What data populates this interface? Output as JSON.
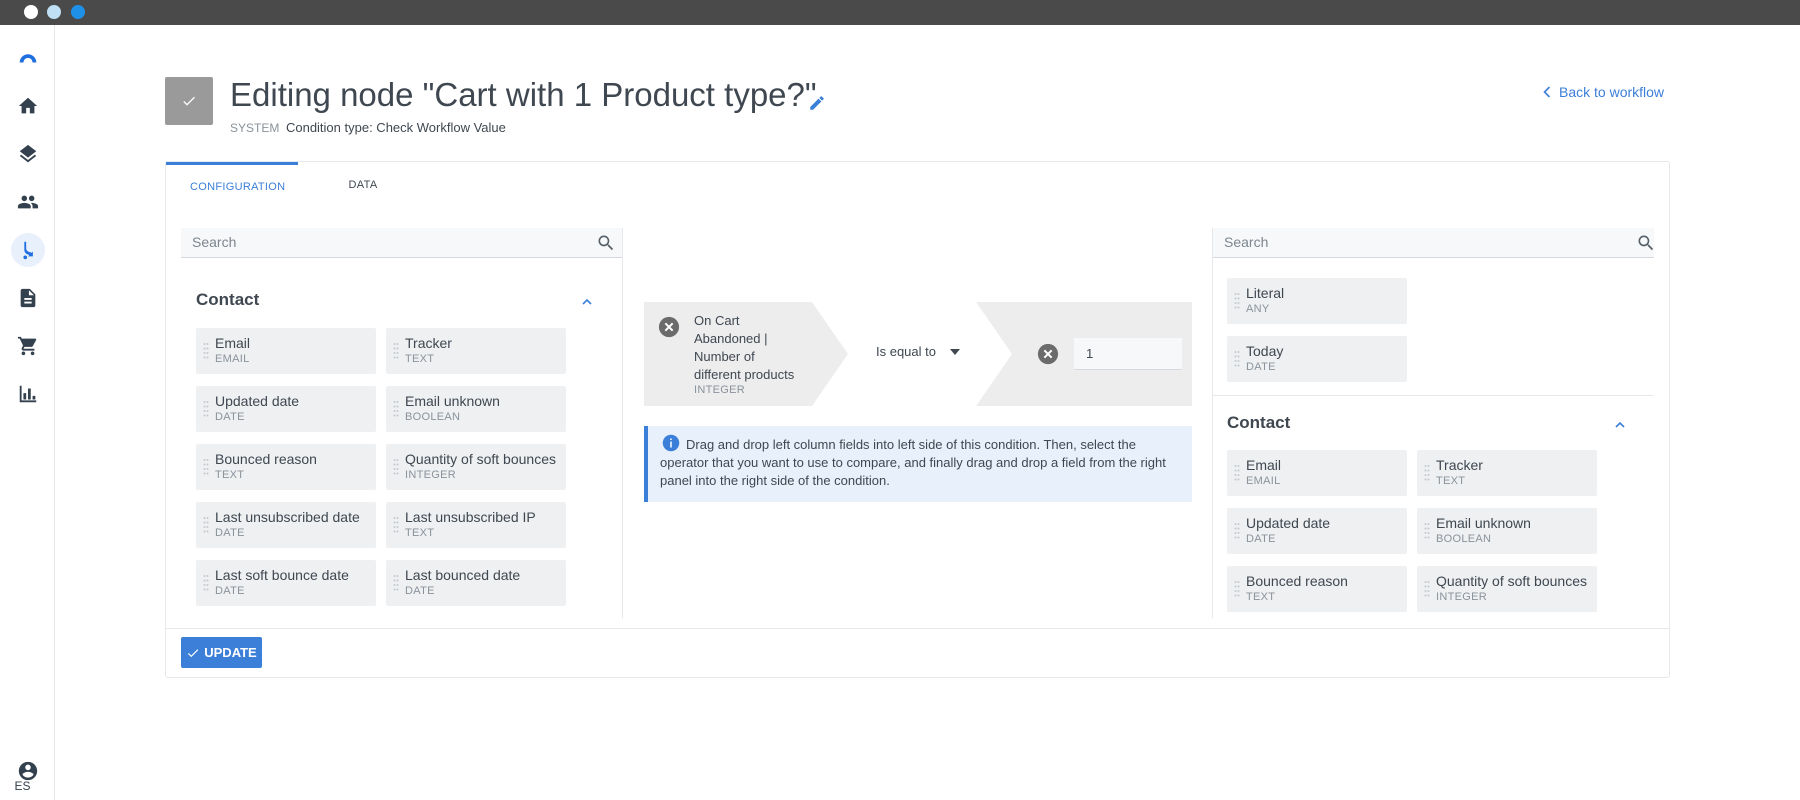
{
  "header": {
    "title": "Editing node \"Cart with 1 Product type?\"",
    "system_label": "SYSTEM",
    "condition_type": "Condition type: Check Workflow Value",
    "back_link": "Back to workflow"
  },
  "sidebar": {
    "items": [
      {
        "icon": "logo-icon"
      },
      {
        "icon": "home-icon"
      },
      {
        "icon": "layers-icon"
      },
      {
        "icon": "people-icon"
      },
      {
        "icon": "workflow-icon",
        "active": true
      },
      {
        "icon": "document-icon"
      },
      {
        "icon": "cart-icon"
      },
      {
        "icon": "chart-icon"
      }
    ],
    "language": "ES"
  },
  "tabs": [
    {
      "label": "CONFIGURATION",
      "active": true
    },
    {
      "label": "DATA",
      "active": false
    }
  ],
  "left_panel": {
    "search_placeholder": "Search",
    "section_title": "Contact",
    "fields": [
      {
        "name": "Email",
        "type": "EMAIL"
      },
      {
        "name": "Tracker",
        "type": "TEXT"
      },
      {
        "name": "Updated date",
        "type": "DATE"
      },
      {
        "name": "Email unknown",
        "type": "BOOLEAN"
      },
      {
        "name": "Bounced reason",
        "type": "TEXT"
      },
      {
        "name": "Quantity of soft bounces",
        "type": "INTEGER"
      },
      {
        "name": "Last unsubscribed date",
        "type": "DATE"
      },
      {
        "name": "Last unsubscribed IP",
        "type": "TEXT"
      },
      {
        "name": "Last soft bounce date",
        "type": "DATE"
      },
      {
        "name": "Last bounced date",
        "type": "DATE"
      }
    ]
  },
  "condition": {
    "field_name": "On Cart Abandoned | Number of different products",
    "field_type": "INTEGER",
    "operator": "Is equal to",
    "value": "1"
  },
  "info_text": "Drag and drop left column fields into left side of this condition. Then, select the operator that you want to use to compare, and finally drag and drop a field from the right panel into the right side of the condition.",
  "right_panel": {
    "search_placeholder": "Search",
    "special_fields": [
      {
        "name": "Literal",
        "type": "ANY"
      },
      {
        "name": "Today",
        "type": "DATE"
      }
    ],
    "section_title": "Contact",
    "fields": [
      {
        "name": "Email",
        "type": "EMAIL"
      },
      {
        "name": "Tracker",
        "type": "TEXT"
      },
      {
        "name": "Updated date",
        "type": "DATE"
      },
      {
        "name": "Email unknown",
        "type": "BOOLEAN"
      },
      {
        "name": "Bounced reason",
        "type": "TEXT"
      },
      {
        "name": "Quantity of soft bounces",
        "type": "INTEGER"
      }
    ]
  },
  "footer": {
    "update_label": "UPDATE"
  },
  "colors": {
    "accent": "#3c7fd8",
    "text": "#3f4750",
    "muted": "#8a929b",
    "field_bg": "#eef0f2"
  }
}
